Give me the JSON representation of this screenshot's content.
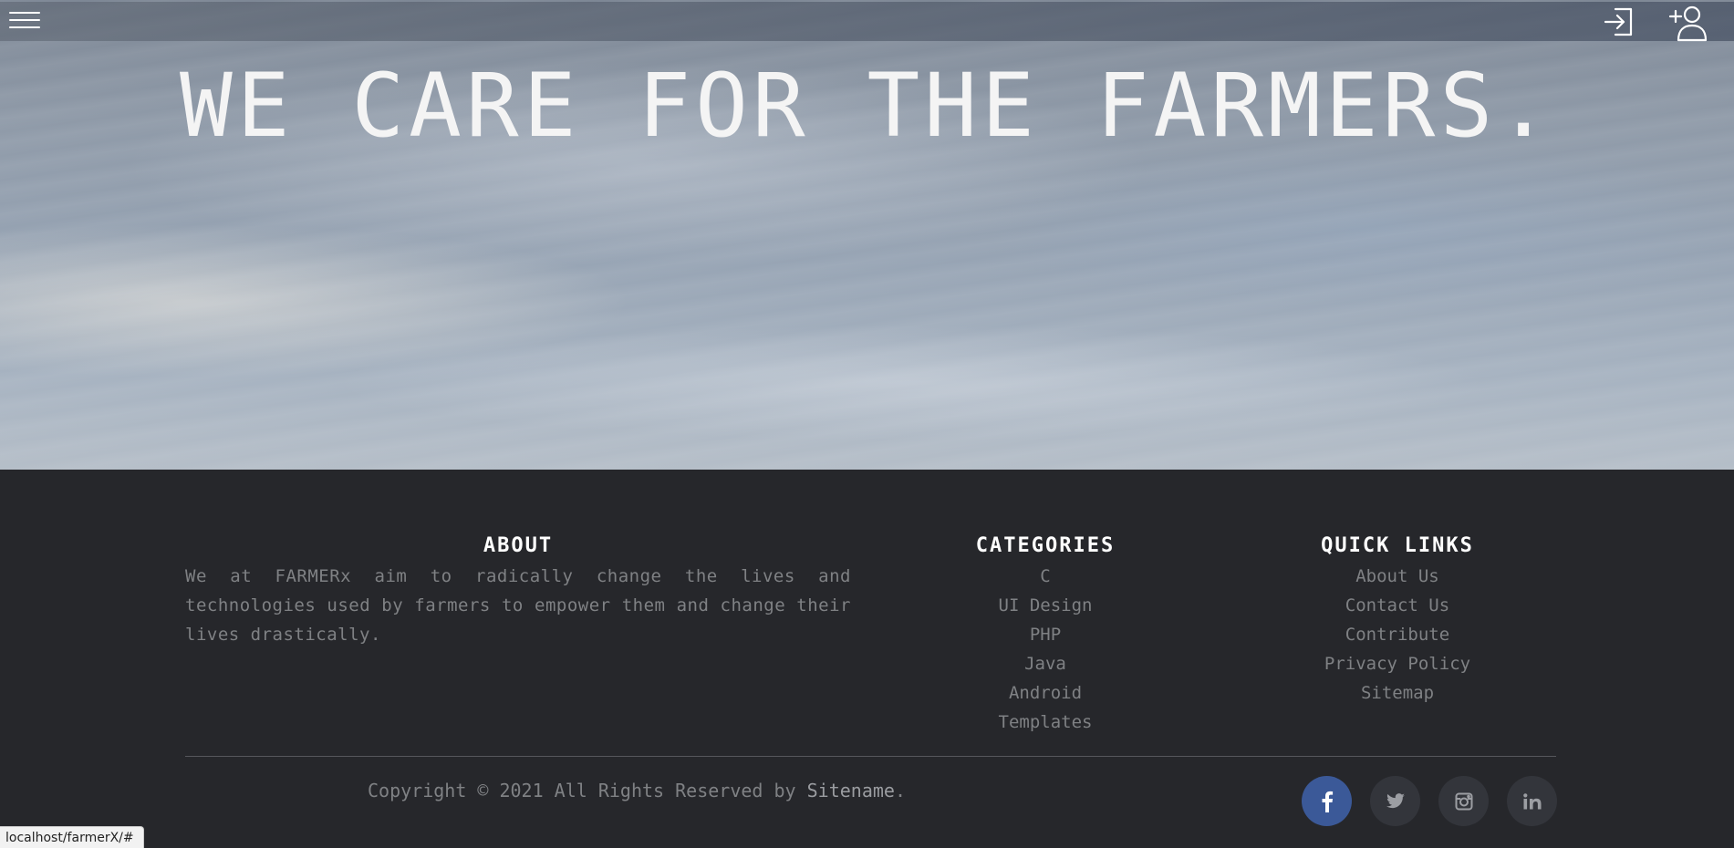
{
  "hero": {
    "title": "WE CARE FOR THE FARMERS."
  },
  "header": {
    "menu_icon": "hamburger-menu-icon",
    "login_icon": "sign-in-icon",
    "signup_icon": "user-plus-icon"
  },
  "footer": {
    "about": {
      "heading": "ABOUT",
      "text": "We at FARMERx aim to radically change the lives and technologies used by farmers to empower them and change their lives drastically."
    },
    "categories": {
      "heading": "CATEGORIES",
      "items": [
        "C",
        "UI Design",
        "PHP",
        "Java",
        "Android",
        "Templates"
      ]
    },
    "quick_links": {
      "heading": "QUICK LINKS",
      "items": [
        "About Us",
        "Contact Us",
        "Contribute",
        "Privacy Policy",
        "Sitemap"
      ]
    },
    "copyright_prefix": "Copyright © 2021 All Rights Reserved by ",
    "copyright_brand": "Sitename",
    "copyright_suffix": ".",
    "social": [
      {
        "name": "facebook-icon",
        "color": "#3b5998"
      },
      {
        "name": "twitter-icon",
        "color": "#33353b"
      },
      {
        "name": "instagram-icon",
        "color": "#33353b"
      },
      {
        "name": "linkedin-icon",
        "color": "#33353b"
      }
    ]
  },
  "status_bar": {
    "url": "localhost/farmerX/#"
  },
  "colors": {
    "footer_bg": "#26272b",
    "footer_text": "#7f8184",
    "heading": "#ffffff",
    "facebook": "#3b5998"
  }
}
